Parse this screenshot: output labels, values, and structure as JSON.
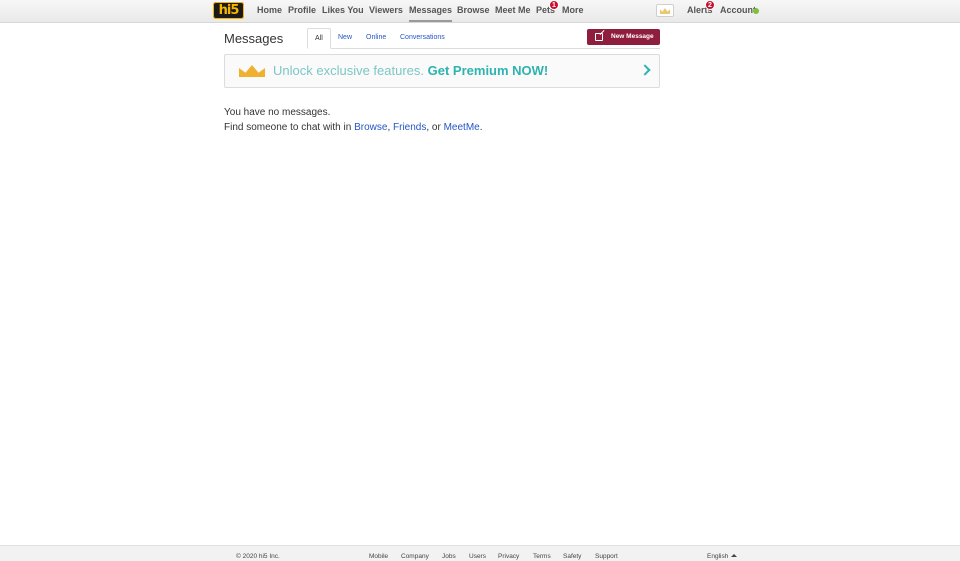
{
  "nav": {
    "logo": "hi5",
    "items": [
      {
        "label": "Home"
      },
      {
        "label": "Profile"
      },
      {
        "label": "Likes You"
      },
      {
        "label": "Viewers"
      },
      {
        "label": "Messages"
      },
      {
        "label": "Browse"
      },
      {
        "label": "Meet Me"
      },
      {
        "label": "Pets",
        "badge": "1"
      },
      {
        "label": "More"
      }
    ],
    "alerts": {
      "label": "Alerts",
      "badge": "2"
    },
    "account": {
      "label": "Account",
      "status_color": "#7cc13a"
    }
  },
  "header": {
    "title": "Messages",
    "tabs": [
      {
        "label": "All"
      },
      {
        "label": "New"
      },
      {
        "label": "Online"
      },
      {
        "label": "Conversations"
      }
    ],
    "new_message_label": "New Message"
  },
  "premium": {
    "text": "Unlock exclusive features.",
    "cta": "Get Premium NOW!"
  },
  "empty_state": {
    "line1": "You have no messages.",
    "line2_prefix": "Find someone to chat with in",
    "link_browse": "Browse",
    "sep1": ",",
    "link_friends": "Friends",
    "sep2": ", or",
    "link_meetme": "MeetMe",
    "suffix": "."
  },
  "footer": {
    "copyright": "© 2020 hi5 Inc.",
    "links": [
      {
        "label": "Mobile"
      },
      {
        "label": "Company"
      },
      {
        "label": "Jobs"
      },
      {
        "label": "Users"
      },
      {
        "label": "Privacy"
      },
      {
        "label": "Terms"
      },
      {
        "label": "Safety"
      },
      {
        "label": "Support"
      }
    ],
    "language": "English"
  },
  "colors": {
    "brand_accent": "#8f1d3e",
    "link": "#2456c6",
    "premium_teal": "#2db3b0",
    "badge_red": "#c8102e"
  }
}
